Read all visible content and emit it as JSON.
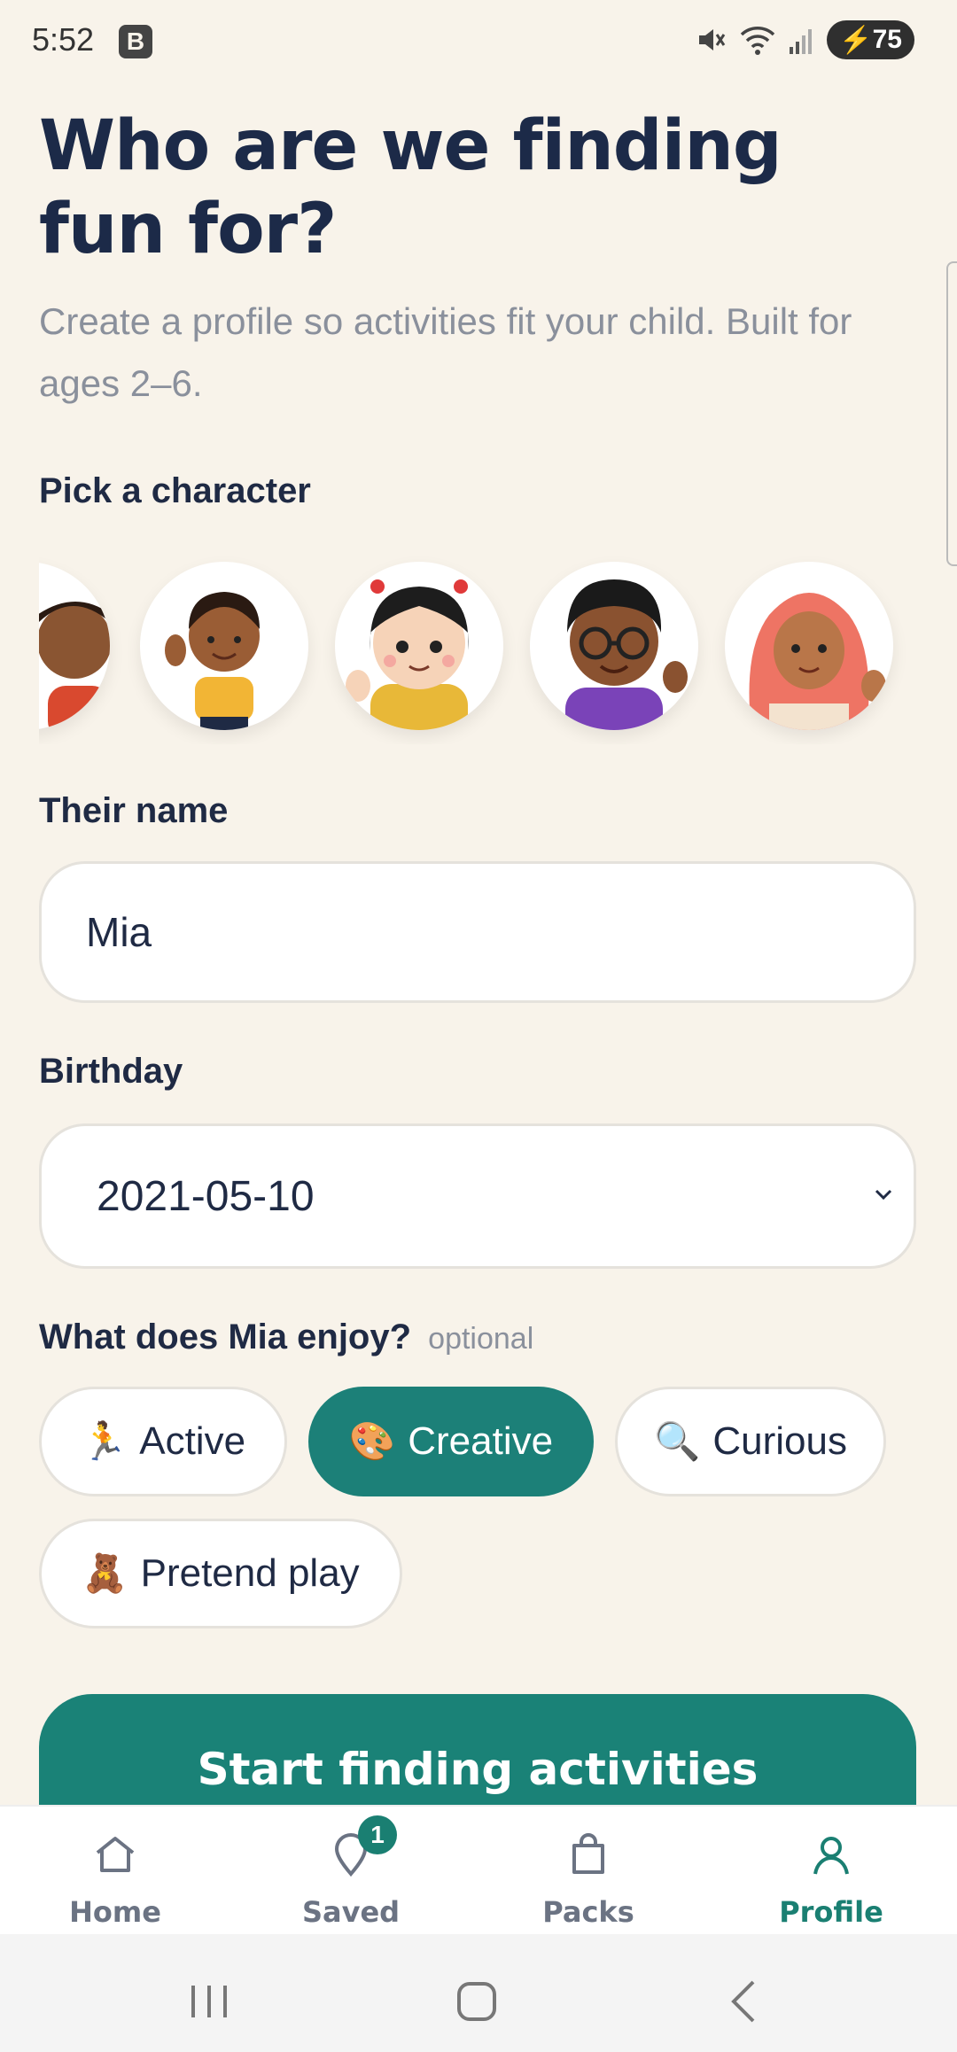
{
  "status_bar": {
    "time": "5:52",
    "b_badge": "B",
    "battery": "75"
  },
  "header": {
    "title": "Who are we finding fun for?",
    "subtitle": "Create a profile so activities fit your child. Built for ages 2–6."
  },
  "character_picker": {
    "label": "Pick a character",
    "characters": [
      {
        "name": "boy-red-shirt"
      },
      {
        "name": "boy-yellow-shirt"
      },
      {
        "name": "girl-yellow-jacket"
      },
      {
        "name": "boy-glasses-purple"
      },
      {
        "name": "girl-hijab"
      }
    ]
  },
  "name_field": {
    "label": "Their name",
    "value": "Mia"
  },
  "birthday_field": {
    "label": "Birthday",
    "value": "2021-05-10"
  },
  "interests": {
    "label": "What does Mia enjoy?",
    "optional": "optional",
    "chips": [
      {
        "emoji": "🏃",
        "label": "Active",
        "selected": false
      },
      {
        "emoji": "🎨",
        "label": "Creative",
        "selected": true
      },
      {
        "emoji": "🔍",
        "label": "Curious",
        "selected": false
      },
      {
        "emoji": "🧸",
        "label": "Pretend play",
        "selected": false
      }
    ]
  },
  "cta": {
    "label": "Start finding activities"
  },
  "tabbar": {
    "tabs": [
      {
        "label": "Home",
        "icon": "home-icon"
      },
      {
        "label": "Saved",
        "icon": "saved-pin-icon",
        "badge": "1"
      },
      {
        "label": "Packs",
        "icon": "bag-icon"
      },
      {
        "label": "Profile",
        "icon": "person-icon",
        "active": true
      }
    ]
  },
  "colors": {
    "background": "#f8f3ea",
    "accent": "#1a8277",
    "text": "#1f2a44",
    "muted": "#8a909c"
  }
}
